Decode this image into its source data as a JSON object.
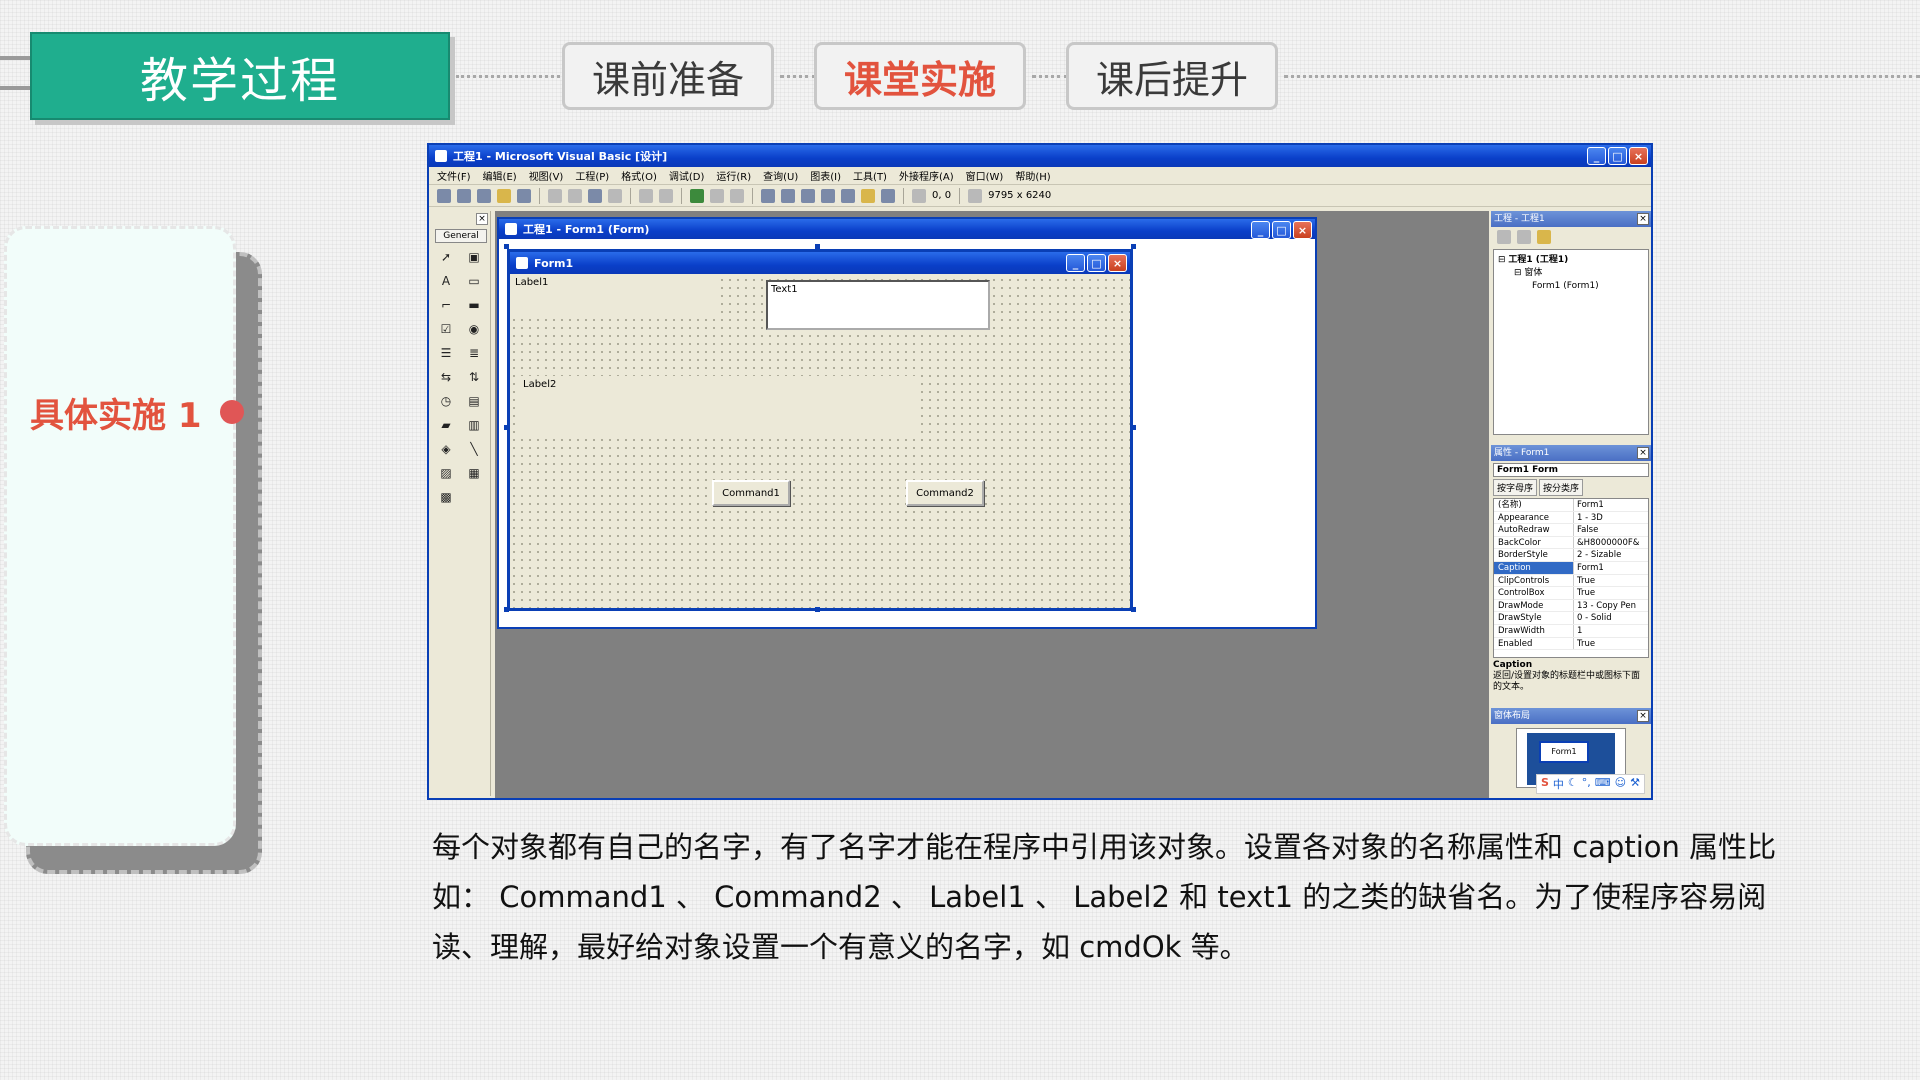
{
  "header": {
    "title": "教学过程",
    "tabs": [
      {
        "label": "课前准备",
        "active": false
      },
      {
        "label": "课堂实施",
        "active": true
      },
      {
        "label": "课后提升",
        "active": false
      }
    ]
  },
  "sidebar": {
    "label": "具体实施 1"
  },
  "ide": {
    "title": "工程1 - Microsoft Visual Basic [设计]",
    "menu": [
      "文件(F)",
      "编辑(E)",
      "视图(V)",
      "工程(P)",
      "格式(O)",
      "调试(D)",
      "运行(R)",
      "查询(U)",
      "图表(I)",
      "工具(T)",
      "外接程序(A)",
      "窗口(W)",
      "帮助(H)"
    ],
    "toolbar": {
      "position": "0, 0",
      "size": "9795 x 6240"
    },
    "toolbox": {
      "tab": "General"
    },
    "designer_title": "工程1 - Form1 (Form)",
    "form": {
      "caption": "Form1",
      "label1": "Label1",
      "label2": "Label2",
      "text1": "Text1",
      "command1": "Command1",
      "command2": "Command2"
    },
    "project_panel": {
      "title": "工程 - 工程1",
      "tree": [
        "工程1 (工程1)",
        "窗体",
        "Form1 (Form1)"
      ]
    },
    "properties_panel": {
      "title": "属性 - Form1",
      "object": "Form1 Form",
      "tabs": [
        "按字母序",
        "按分类序"
      ],
      "rows": [
        {
          "k": "(名称)",
          "v": "Form1"
        },
        {
          "k": "Appearance",
          "v": "1 - 3D"
        },
        {
          "k": "AutoRedraw",
          "v": "False"
        },
        {
          "k": "BackColor",
          "v": "&H8000000F&"
        },
        {
          "k": "BorderStyle",
          "v": "2 - Sizable"
        },
        {
          "k": "Caption",
          "v": "Form1"
        },
        {
          "k": "ClipControls",
          "v": "True"
        },
        {
          "k": "ControlBox",
          "v": "True"
        },
        {
          "k": "DrawMode",
          "v": "13 - Copy Pen"
        },
        {
          "k": "DrawStyle",
          "v": "0 - Solid"
        },
        {
          "k": "DrawWidth",
          "v": "1"
        },
        {
          "k": "Enabled",
          "v": "True"
        }
      ],
      "desc_title": "Caption",
      "desc_text": "返回/设置对象的标题栏中或图标下面的文本。"
    },
    "layout_panel": {
      "title": "窗体布局",
      "preview": "Form1"
    },
    "ime": [
      "S",
      "中",
      "☾",
      "°,",
      "⌨",
      "☺",
      "⚒"
    ]
  },
  "caption": "每个对象都有自己的名字，有了名字才能在程序中引用该对象。设置各对象的名称属性和 caption 属性比如： Command1 、 Command2 、 Label1 、 Label2 和 text1 的之类的缺省名。为了使程序容易阅读、理解，最好给对象设置一个有意义的名字，如 cmdOk 等。"
}
